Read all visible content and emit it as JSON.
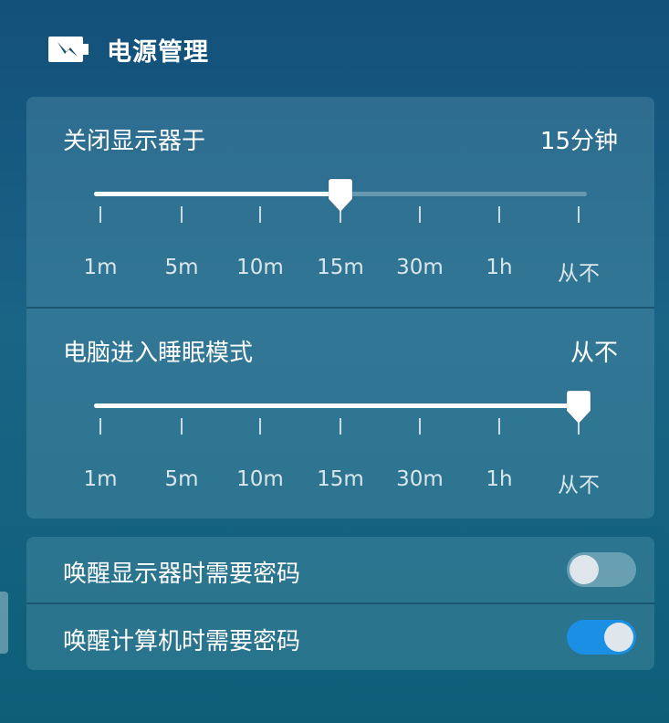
{
  "header": {
    "title": "电源管理",
    "icon": "battery-charging-icon"
  },
  "display_off": {
    "title": "关闭显示器于",
    "value": "15分钟",
    "ticks": [
      "1m",
      "5m",
      "10m",
      "15m",
      "30m",
      "1h",
      "从不"
    ],
    "selected_index": 3
  },
  "sleep": {
    "title": "电脑进入睡眠模式",
    "value": "从不",
    "ticks": [
      "1m",
      "5m",
      "10m",
      "15m",
      "30m",
      "1h",
      "从不"
    ],
    "selected_index": 6
  },
  "toggles": [
    {
      "label": "唤醒显示器时需要密码",
      "on": false
    },
    {
      "label": "唤醒计算机时需要密码",
      "on": true
    }
  ],
  "colors": {
    "accent": "#1a8fe3",
    "background": "#13507a",
    "panel": "#3b7f94"
  }
}
